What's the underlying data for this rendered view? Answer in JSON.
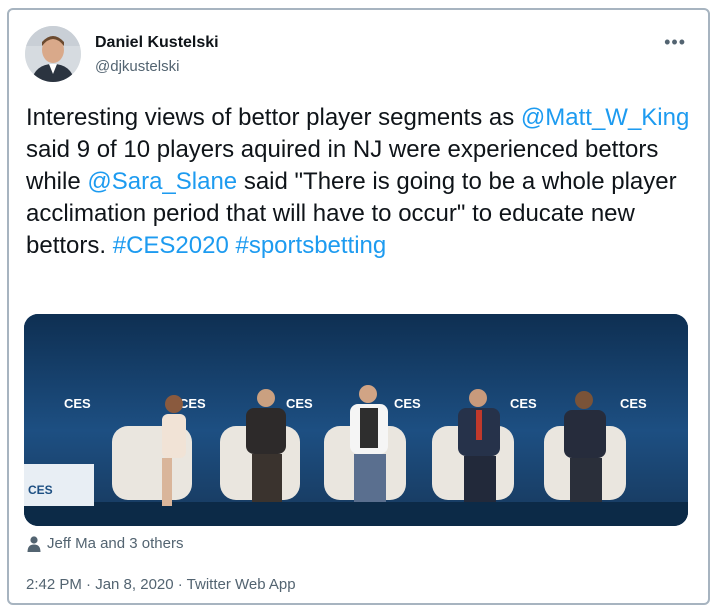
{
  "author": {
    "name": "Daniel Kustelski",
    "handle": "@djkustelski"
  },
  "tweet": {
    "segments": [
      {
        "text": "Interesting views of bettor player segments as ",
        "type": "text"
      },
      {
        "text": "@Matt_W_King",
        "type": "mention"
      },
      {
        "text": " said 9 of 10 players aquired in NJ were experienced bettors while ",
        "type": "text"
      },
      {
        "text": "@Sara_Slane",
        "type": "mention"
      },
      {
        "text": " said \"There is going to be a whole player acclimation period that will have to occur\" to educate new bettors. ",
        "type": "text"
      },
      {
        "text": "#CES2020",
        "type": "hashtag"
      },
      {
        "text": " ",
        "type": "text"
      },
      {
        "text": "#sportsbetting",
        "type": "hashtag"
      }
    ]
  },
  "media": {
    "logo_text": "CES"
  },
  "likes": {
    "text": "Jeff Ma and 3 others",
    "icon": "person-icon"
  },
  "meta": {
    "text": "2:42 PM · Jan 8, 2020 · Twitter Web App"
  },
  "more_icon": "more-icon",
  "colors": {
    "link": "#1d9bf0",
    "secondary": "#536471",
    "stage": "#1a3f66"
  }
}
